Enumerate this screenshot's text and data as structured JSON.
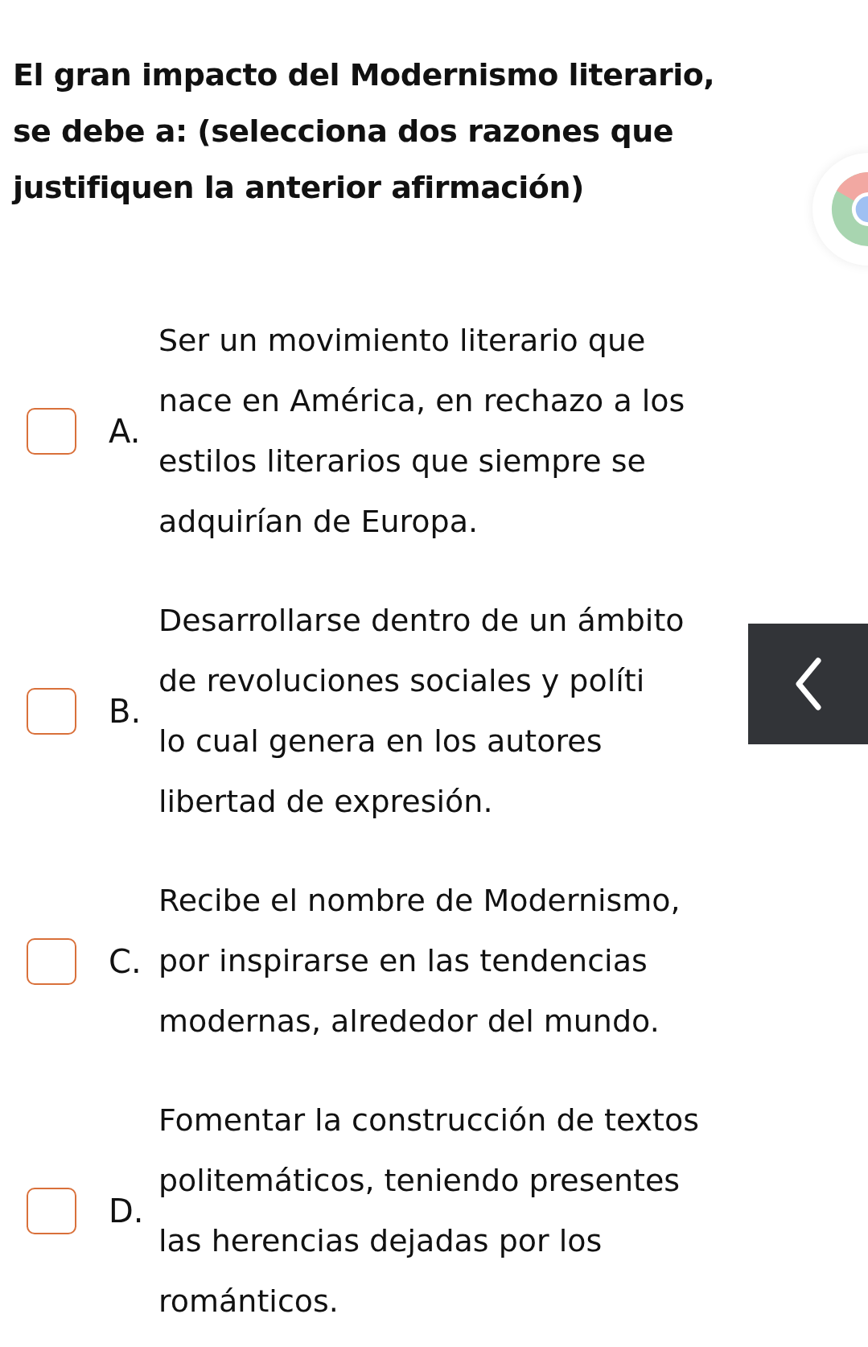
{
  "question": {
    "lines": [
      "El gran impacto del Modernismo literario,",
      "se debe a: (selecciona dos razones que",
      "justifiquen la anterior afirmación)"
    ]
  },
  "options": [
    {
      "letter": "A.",
      "checked": false,
      "lines": [
        "Ser un movimiento literario que",
        "nace en América, en rechazo a los",
        "estilos literarios que siempre se",
        "adquirían de Europa."
      ]
    },
    {
      "letter": "B.",
      "checked": false,
      "lines": [
        "Desarrollarse dentro de un ámbito",
        "de revoluciones sociales y políti",
        "lo cual genera en los autores",
        "libertad de expresión."
      ]
    },
    {
      "letter": "C.",
      "checked": false,
      "lines": [
        "Recibe el nombre de Modernismo,",
        "por inspirarse en las tendencias",
        "modernas, alrededor del mundo."
      ]
    },
    {
      "letter": "D.",
      "checked": false,
      "lines": [
        "Fomentar la construcción de textos",
        "politemáticos, teniendo presentes",
        "las herencias dejadas por los",
        "románticos."
      ]
    }
  ]
}
